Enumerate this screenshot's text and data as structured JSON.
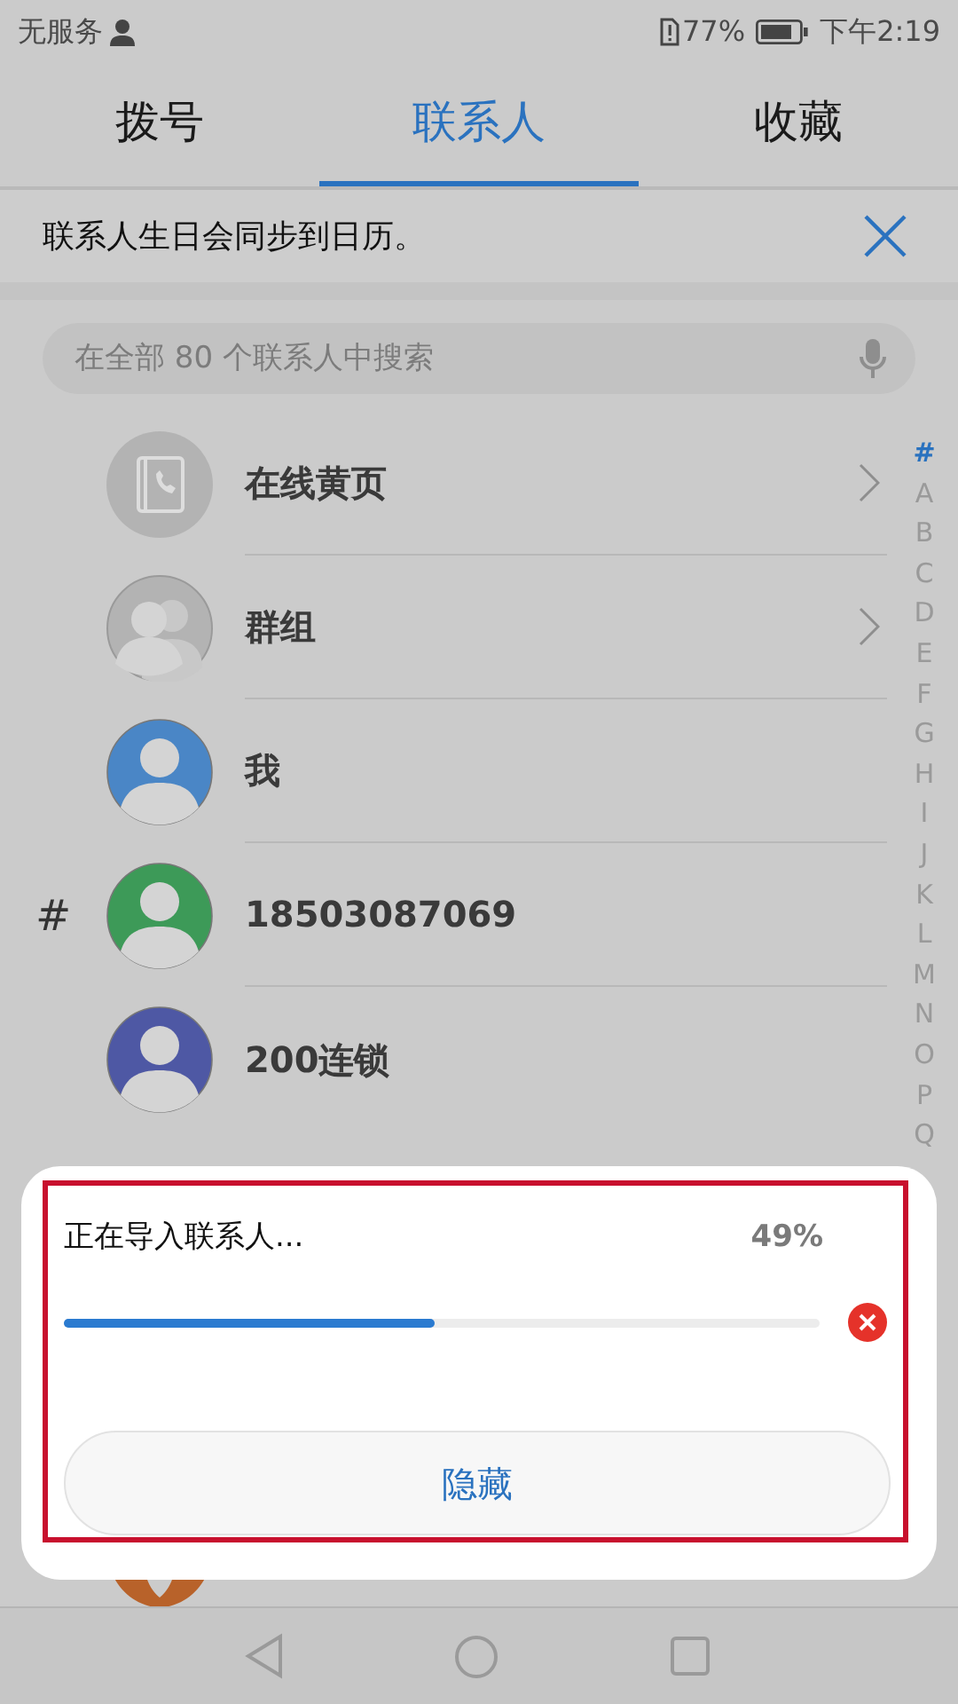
{
  "status_bar": {
    "carrier": "无服务",
    "battery": "77%",
    "time": "下午2:19"
  },
  "tabs": [
    {
      "label": "拨号",
      "selected": false
    },
    {
      "label": "联系人",
      "selected": true
    },
    {
      "label": "收藏",
      "selected": false
    }
  ],
  "notice": {
    "text": "联系人生日会同步到日历。"
  },
  "search": {
    "placeholder": "在全部 80 个联系人中搜索"
  },
  "contacts": [
    {
      "kind": "directory",
      "name": "在线黄页"
    },
    {
      "kind": "group",
      "name": "群组"
    },
    {
      "kind": "person",
      "name": "我",
      "color": "#4a86c6"
    },
    {
      "kind": "person",
      "name": "18503087069",
      "color": "#3d9a58",
      "section": "#"
    },
    {
      "kind": "person",
      "name": "200连锁",
      "color": "#4e58a4"
    }
  ],
  "index": [
    {
      "letter": "#",
      "selected": true
    },
    {
      "letter": "A",
      "selected": false
    },
    {
      "letter": "B",
      "selected": false
    },
    {
      "letter": "C",
      "selected": false
    },
    {
      "letter": "D",
      "selected": false
    },
    {
      "letter": "E",
      "selected": false
    },
    {
      "letter": "F",
      "selected": false
    },
    {
      "letter": "G",
      "selected": false
    },
    {
      "letter": "H",
      "selected": false
    },
    {
      "letter": "I",
      "selected": false
    },
    {
      "letter": "J",
      "selected": false
    },
    {
      "letter": "K",
      "selected": false
    },
    {
      "letter": "L",
      "selected": false
    },
    {
      "letter": "M",
      "selected": false
    },
    {
      "letter": "N",
      "selected": false
    },
    {
      "letter": "O",
      "selected": false
    },
    {
      "letter": "P",
      "selected": false
    },
    {
      "letter": "Q",
      "selected": false
    }
  ],
  "import_dialog": {
    "title": "正在导入联系人...",
    "percent": "49%",
    "level": 0.49,
    "hide_button": "隐藏"
  }
}
